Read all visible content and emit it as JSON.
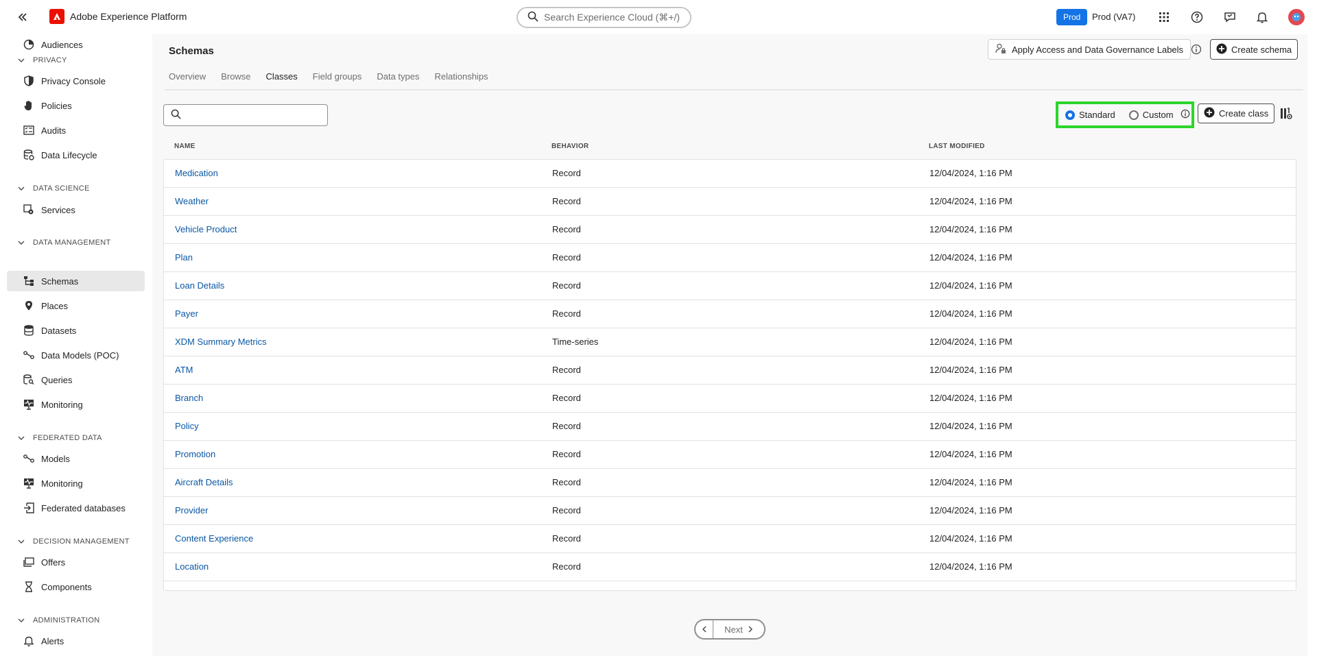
{
  "app": {
    "title": "Adobe Experience Platform",
    "search_placeholder": "Search Experience Cloud (⌘+/)",
    "env_badge": "Prod",
    "env_label": "Prod (VA7)",
    "accent": "#1473e6",
    "brand_color": "#eb1000"
  },
  "sidebar": {
    "top_item": "Audiences",
    "sections": [
      {
        "label": "PRIVACY",
        "items": [
          "Privacy Console",
          "Policies",
          "Audits",
          "Data Lifecycle"
        ]
      },
      {
        "label": "DATA SCIENCE",
        "items": [
          "Services"
        ]
      },
      {
        "label": "DATA MANAGEMENT",
        "items": [
          "Schemas",
          "Places",
          "Datasets",
          "Data Models (POC)",
          "Queries",
          "Monitoring"
        ]
      },
      {
        "label": "FEDERATED DATA",
        "items": [
          "Models",
          "Monitoring",
          "Federated databases"
        ]
      },
      {
        "label": "DECISION MANAGEMENT",
        "items": [
          "Offers",
          "Components"
        ]
      },
      {
        "label": "ADMINISTRATION",
        "items": [
          "Alerts"
        ]
      }
    ],
    "active_item": "Schemas"
  },
  "page": {
    "title": "Schemas",
    "apply_labels_button": "Apply Access and Data Governance Labels",
    "create_schema_button": "Create schema",
    "tabs": [
      "Overview",
      "Browse",
      "Classes",
      "Field groups",
      "Data types",
      "Relationships"
    ],
    "active_tab": "Classes",
    "search_value": "",
    "filter": {
      "options": [
        "Standard",
        "Custom"
      ],
      "selected": "Standard",
      "highlight_color": "#2cd52c"
    },
    "create_class_button": "Create class"
  },
  "table": {
    "columns": [
      "NAME",
      "BEHAVIOR",
      "LAST MODIFIED"
    ],
    "rows": [
      {
        "name": "Medication",
        "behavior": "Record",
        "modified": "12/04/2024, 1:16 PM"
      },
      {
        "name": "Weather",
        "behavior": "Record",
        "modified": "12/04/2024, 1:16 PM"
      },
      {
        "name": "Vehicle Product",
        "behavior": "Record",
        "modified": "12/04/2024, 1:16 PM"
      },
      {
        "name": "Plan",
        "behavior": "Record",
        "modified": "12/04/2024, 1:16 PM"
      },
      {
        "name": "Loan Details",
        "behavior": "Record",
        "modified": "12/04/2024, 1:16 PM"
      },
      {
        "name": "Payer",
        "behavior": "Record",
        "modified": "12/04/2024, 1:16 PM"
      },
      {
        "name": "XDM Summary Metrics",
        "behavior": "Time-series",
        "modified": "12/04/2024, 1:16 PM"
      },
      {
        "name": "ATM",
        "behavior": "Record",
        "modified": "12/04/2024, 1:16 PM"
      },
      {
        "name": "Branch",
        "behavior": "Record",
        "modified": "12/04/2024, 1:16 PM"
      },
      {
        "name": "Policy",
        "behavior": "Record",
        "modified": "12/04/2024, 1:16 PM"
      },
      {
        "name": "Promotion",
        "behavior": "Record",
        "modified": "12/04/2024, 1:16 PM"
      },
      {
        "name": "Aircraft Details",
        "behavior": "Record",
        "modified": "12/04/2024, 1:16 PM"
      },
      {
        "name": "Provider",
        "behavior": "Record",
        "modified": "12/04/2024, 1:16 PM"
      },
      {
        "name": "Content Experience",
        "behavior": "Record",
        "modified": "12/04/2024, 1:16 PM"
      },
      {
        "name": "Location",
        "behavior": "Record",
        "modified": "12/04/2024, 1:16 PM"
      }
    ]
  },
  "pagination": {
    "next_label": "Next"
  }
}
